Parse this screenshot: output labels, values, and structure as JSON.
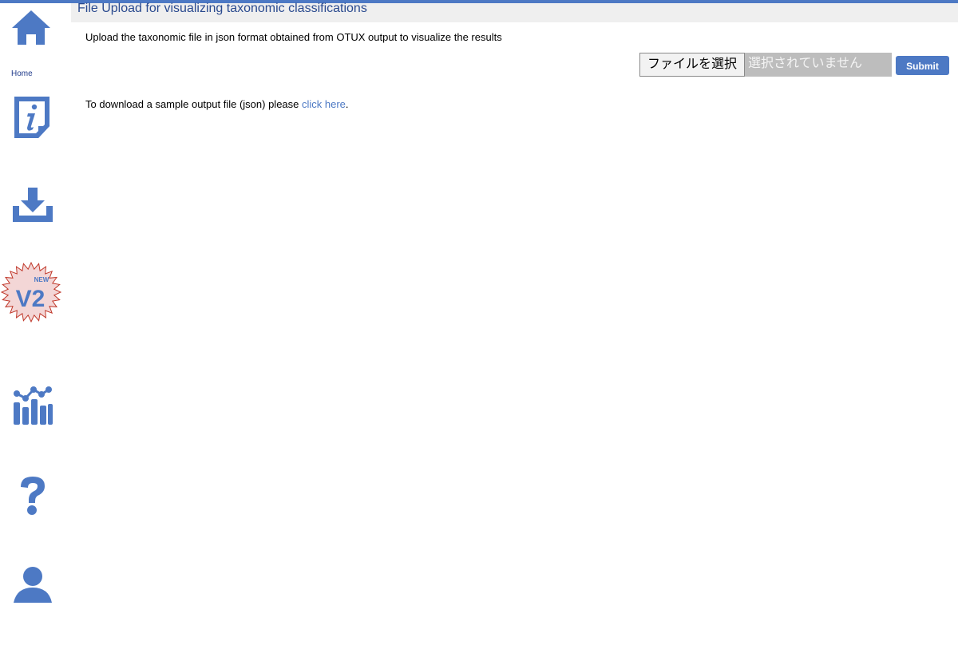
{
  "sidebar": {
    "home_label": "Home",
    "icons": [
      "home-icon",
      "info-icon",
      "download-icon",
      "v2-new-badge-icon",
      "stats-chart-icon",
      "help-icon",
      "user-icon"
    ],
    "v2_badge_new": "NEW",
    "v2_badge_text": "V2"
  },
  "header": {
    "title": "File Upload for visualizing taxonomic classifications"
  },
  "main": {
    "intro": "Upload the taxonomic file in json format obtained from OTUX output to visualize the results",
    "file_button_label": "ファイルを選択",
    "file_status": "選択されていません",
    "submit_label": "Submit",
    "download_prefix": "To download a sample output file (json) please ",
    "download_link_text": "click here",
    "download_suffix": "."
  },
  "colors": {
    "accent": "#4d79c4",
    "title_text": "#2a4a8f",
    "header_bg": "#efefef",
    "badge_bg": "#f3d6d6",
    "badge_border": "#c0392b"
  }
}
